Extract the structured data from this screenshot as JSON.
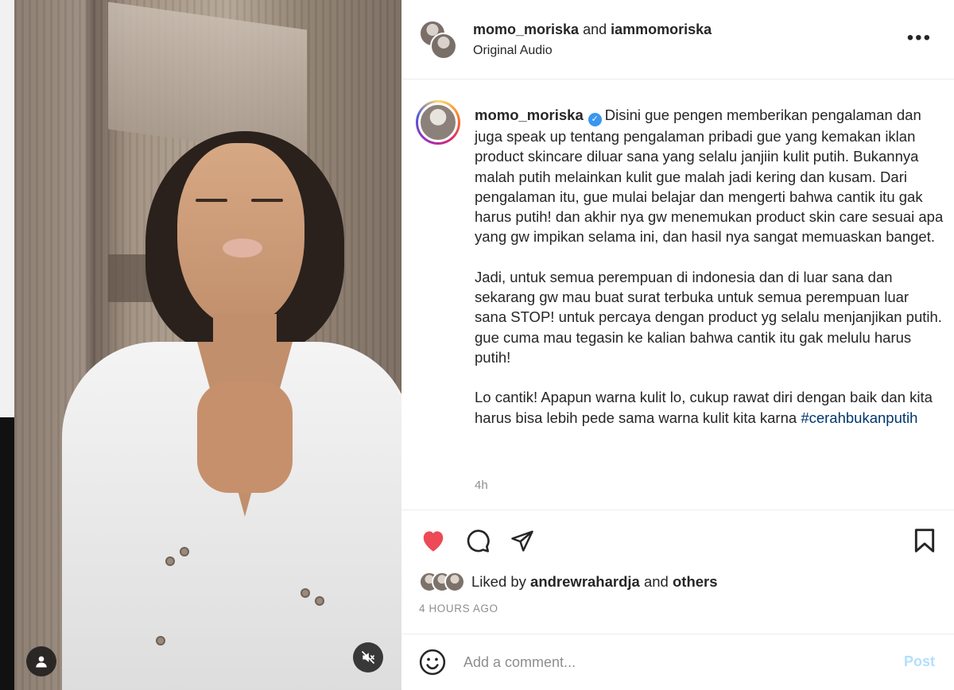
{
  "header": {
    "user1": "momo_moriska",
    "joiner": "and",
    "user2": "iammomoriska",
    "audio": "Original Audio",
    "more_label": "•••"
  },
  "caption": {
    "username": "momo_moriska",
    "verified_mark": "✓",
    "paragraph1": "Disini gue pengen memberikan pengalaman dan juga speak up tentang pengalaman pribadi gue yang kemakan iklan product skincare diluar sana yang selalu janjiin kulit putih. Bukannya malah putih melainkan kulit gue malah jadi kering dan kusam. Dari pengalaman itu, gue mulai belajar dan mengerti bahwa cantik itu gak harus putih! dan akhir nya gw menemukan product skin care sesuai apa yang gw impikan selama ini, dan hasil nya sangat memuaskan banget.",
    "paragraph2": "Jadi, untuk semua perempuan di indonesia dan di luar sana dan sekarang gw mau buat surat terbuka untuk semua perempuan luar sana STOP! untuk percaya dengan product yg selalu menjanjikan putih. gue cuma mau tegasin ke kalian bahwa cantik itu gak melulu harus putih!",
    "paragraph3": "Lo cantik! Apapun warna kulit lo, cukup rawat diri dengan baik dan kita harus bisa lebih pede sama warna kulit kita karna",
    "hashtag": "#cerahbukanputih",
    "ago": "4h"
  },
  "likes": {
    "prefix": "Liked by",
    "user": "andrewrahardja",
    "joiner": "and",
    "others": "others"
  },
  "timestamp": "4 HOURS AGO",
  "comment": {
    "placeholder": "Add a comment...",
    "post_label": "Post"
  },
  "colors": {
    "like_red": "#ed4956",
    "link_blue": "#00376b",
    "post_disabled": "#b2dffc",
    "verified_blue": "#3897f0"
  },
  "icons": [
    "user-icon",
    "mute-icon",
    "heart-icon",
    "comment-icon",
    "share-icon",
    "bookmark-icon",
    "emoji-icon",
    "more-icon",
    "verified-icon"
  ]
}
